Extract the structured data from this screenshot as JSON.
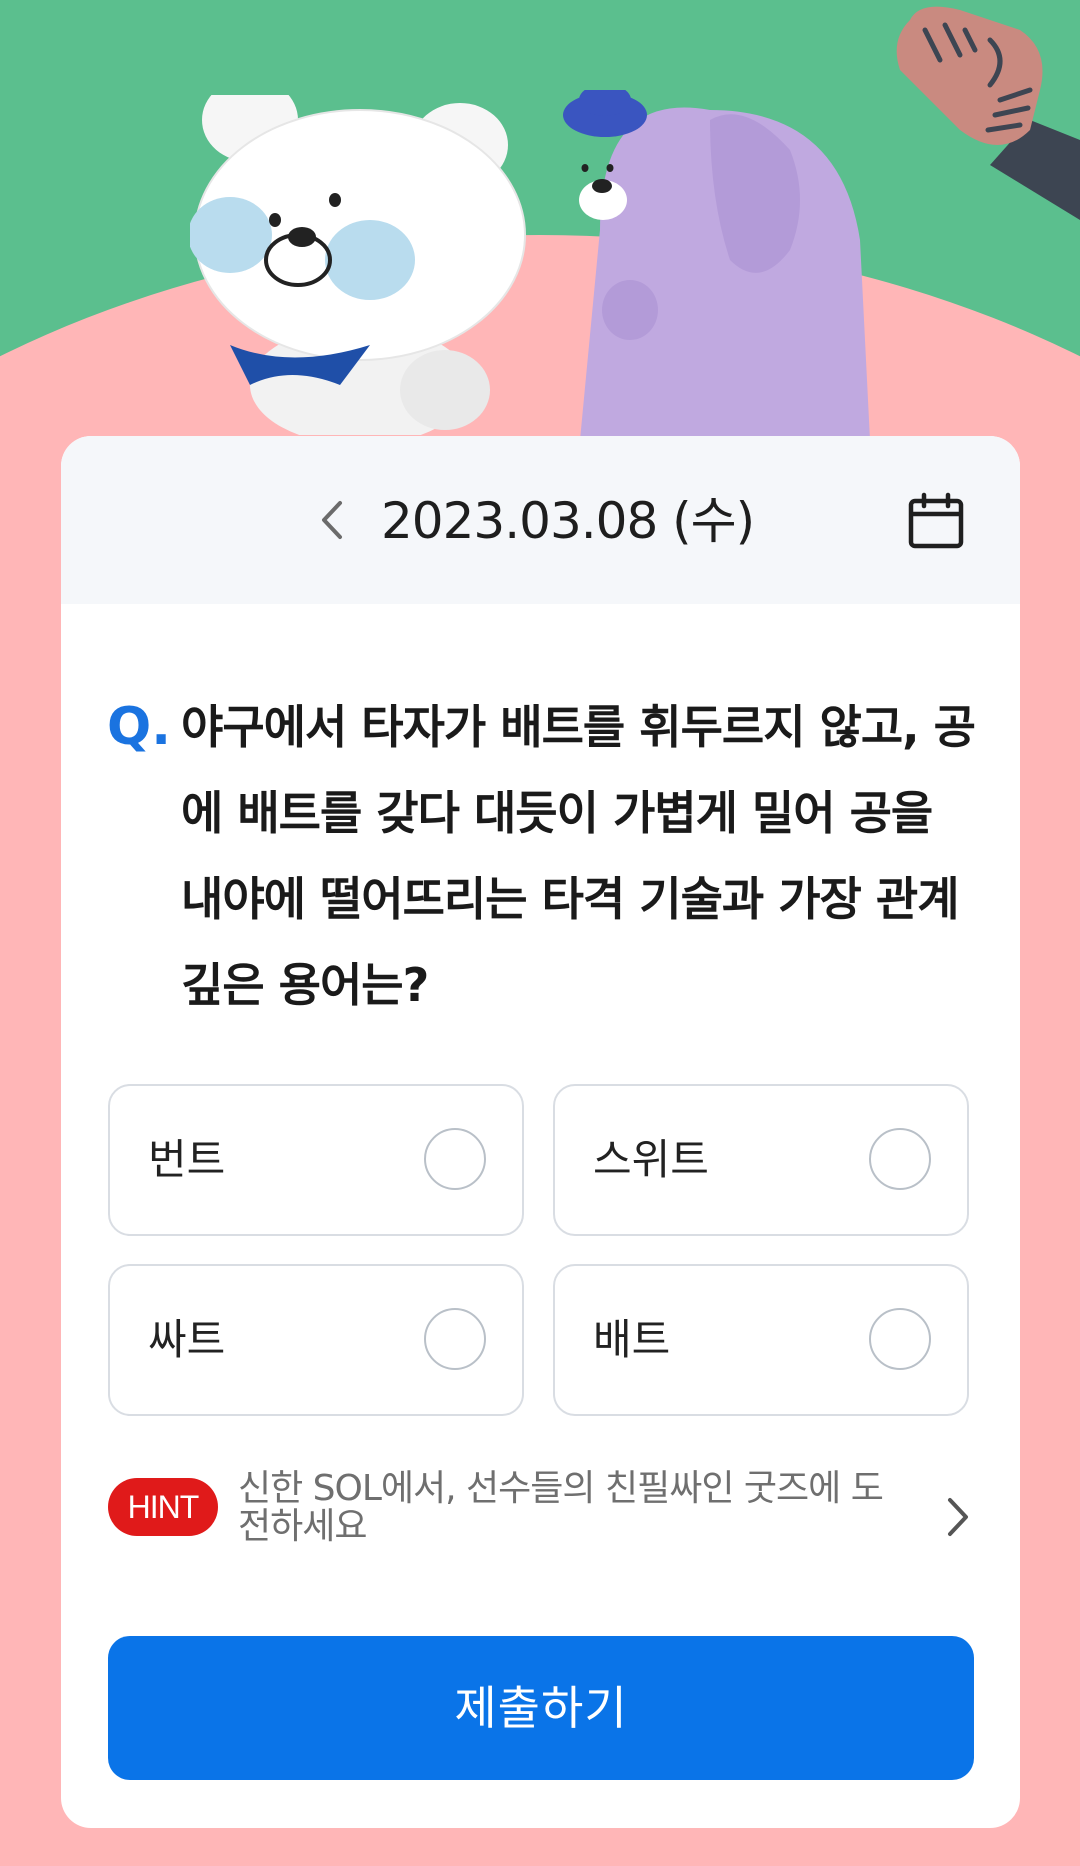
{
  "header": {
    "date": "2023.03.08 (수)",
    "prev_icon": "chevron-left-icon",
    "calendar_icon": "calendar-icon"
  },
  "question": {
    "mark": "Q.",
    "text": "야구에서 타자가 배트를 휘두르지 않고, 공에 배트를 갖다 대듯이 가볍게 밀어 공을 내야에 떨어뜨리는 타격 기술과 가장 관계 깊은 용어는?"
  },
  "options": [
    {
      "label": "번트"
    },
    {
      "label": "스위트"
    },
    {
      "label": "싸트"
    },
    {
      "label": "배트"
    }
  ],
  "hint": {
    "badge": "HINT",
    "text": "신한 SOL에서, 선수들의 친필싸인 굿즈에 도전하세요",
    "chevron_icon": "chevron-right-icon"
  },
  "submit": {
    "label": "제출하기"
  },
  "colors": {
    "sky": "#5bbf8e",
    "background": "#ffb6b7",
    "accent": "#0a74e8",
    "question_mark": "#1a73e0",
    "hint_badge": "#e01a1a"
  }
}
